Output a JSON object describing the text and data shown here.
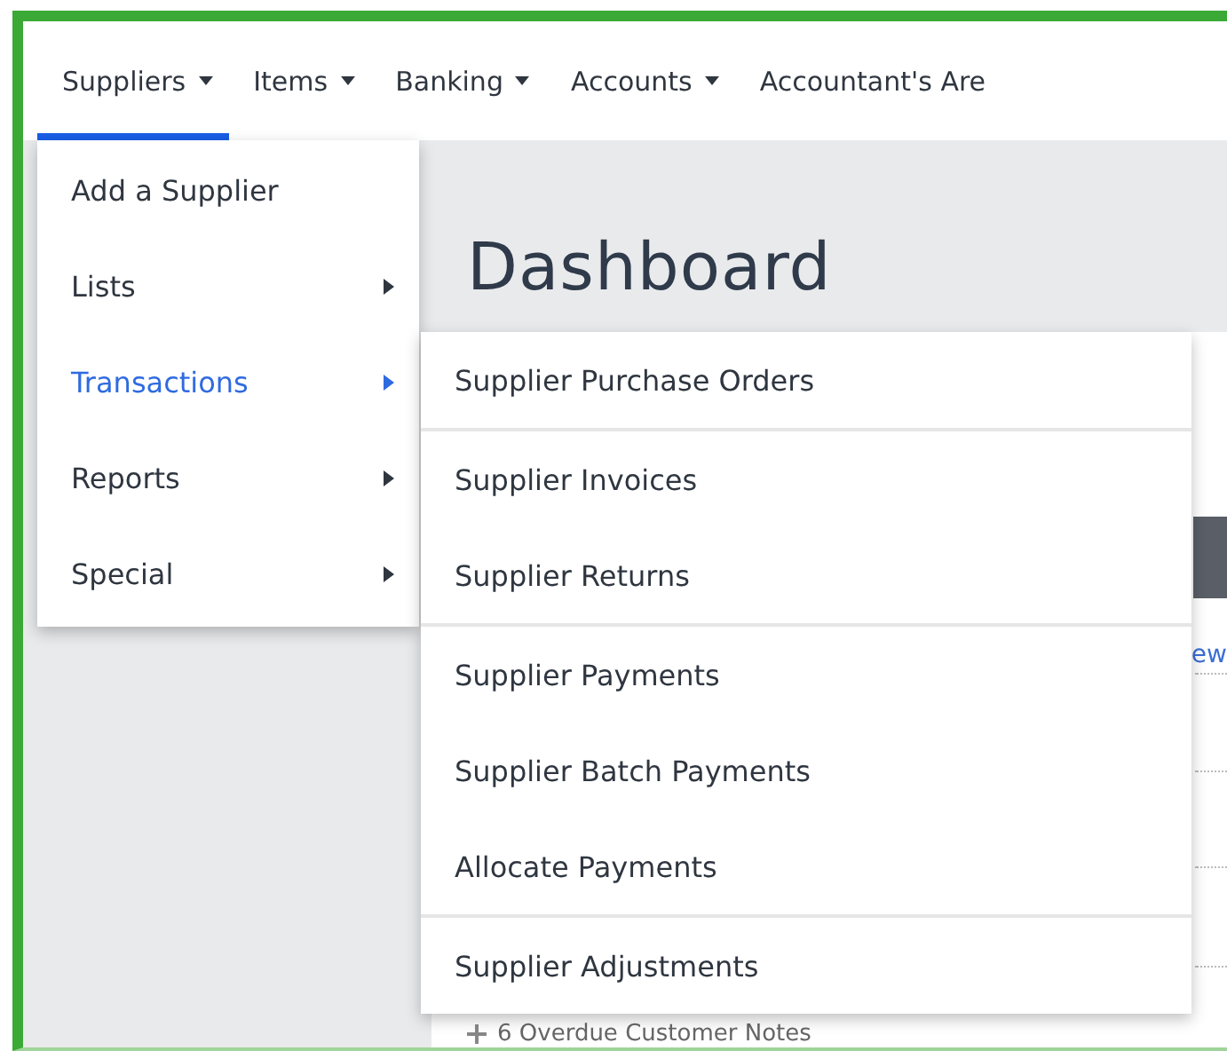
{
  "nav": [
    {
      "label": "Suppliers",
      "selected": true,
      "caret": true
    },
    {
      "label": "Items",
      "selected": false,
      "caret": true
    },
    {
      "label": "Banking",
      "selected": false,
      "caret": true
    },
    {
      "label": "Accounts",
      "selected": false,
      "caret": true
    },
    {
      "label": "Accountant's Are",
      "selected": false,
      "caret": false
    }
  ],
  "menu": [
    {
      "label": "Add a Supplier",
      "selected": false,
      "submenu": false
    },
    {
      "label": "Lists",
      "selected": false,
      "submenu": true
    },
    {
      "label": "Transactions",
      "selected": true,
      "submenu": true
    },
    {
      "label": "Reports",
      "selected": false,
      "submenu": true
    },
    {
      "label": "Special",
      "selected": false,
      "submenu": true
    }
  ],
  "submenu": {
    "groups": [
      {
        "items": [
          "Supplier Purchase Orders"
        ]
      },
      {
        "items": [
          "Supplier Invoices",
          "Supplier Returns"
        ]
      },
      {
        "items": [
          "Supplier Payments",
          "Supplier Batch Payments",
          "Allocate Payments"
        ]
      },
      {
        "items": [
          "Supplier Adjustments"
        ]
      }
    ]
  },
  "page": {
    "title": "Dashboard",
    "link_fragment": "ew",
    "note": "6 Overdue Customer Notes"
  }
}
